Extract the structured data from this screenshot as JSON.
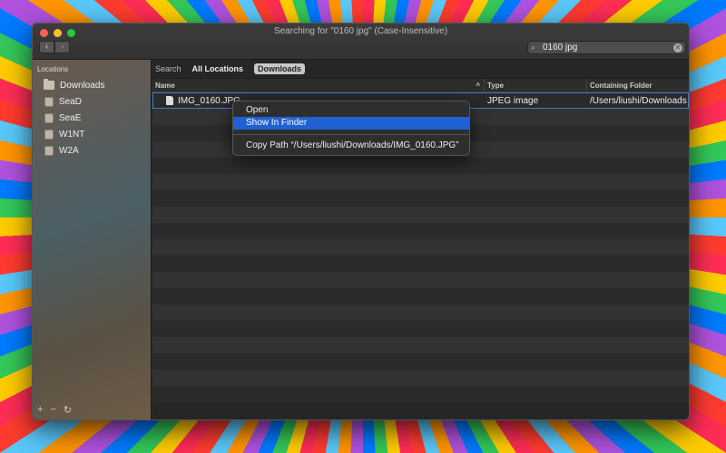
{
  "window": {
    "title": "Searching for \"0160 jpg\" (Case-Insensitive)"
  },
  "toolbar": {
    "back_label": "‹",
    "forward_label": "›",
    "search": {
      "value": "0160 jpg",
      "icon": "search-icon"
    }
  },
  "sidebar": {
    "header": "Locations",
    "items": [
      {
        "label": "Downloads",
        "icon": "folder-icon"
      },
      {
        "label": "SeaD",
        "icon": "drive-icon"
      },
      {
        "label": "SeaE",
        "icon": "drive-icon"
      },
      {
        "label": "W1NT",
        "icon": "drive-icon"
      },
      {
        "label": "W2A",
        "icon": "drive-icon"
      }
    ],
    "footer": {
      "add": "+",
      "remove": "−",
      "refresh": "↻"
    }
  },
  "scope": {
    "label": "Search",
    "options": [
      "All Locations",
      "Downloads"
    ],
    "selected": "Downloads"
  },
  "columns": {
    "name": "Name",
    "type": "Type",
    "folder": "Containing Folder",
    "sort_caret": "^"
  },
  "results": [
    {
      "name": "IMG_0160.JPG",
      "type": "JPEG image",
      "folder": "/Users/liushi/Downloads"
    }
  ],
  "context_menu": {
    "items": [
      {
        "label": "Open"
      },
      {
        "label": "Show In Finder",
        "highlighted": true
      },
      {
        "label": "Copy Path “/Users/liushi/Downloads/IMG_0160.JPG”"
      }
    ]
  },
  "colors": {
    "accent": "#1f61d1",
    "selection_outline": "#3a7bd5"
  }
}
